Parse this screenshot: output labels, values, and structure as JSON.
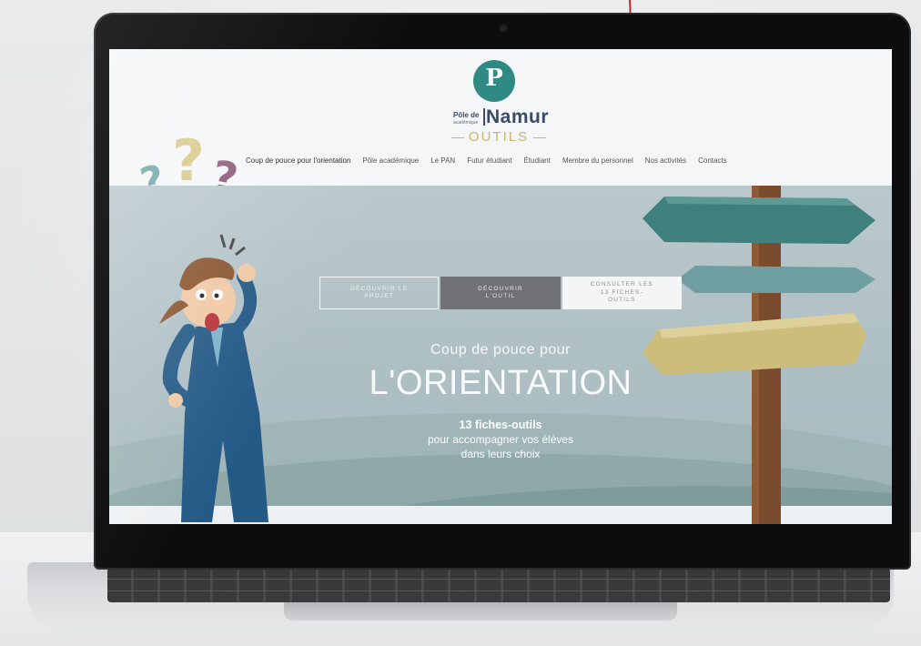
{
  "site": {
    "logo": {
      "glyph": "P",
      "pole": "Pôle de",
      "academique": "académique",
      "namur": "Namur",
      "outils": "OUTILS"
    },
    "nav": [
      {
        "label": "Coup de pouce pour l'orientation",
        "active": true
      },
      {
        "label": "Pôle académique"
      },
      {
        "label": "Le PAN"
      },
      {
        "label": "Futur étudiant"
      },
      {
        "label": "Étudiant"
      },
      {
        "label": "Membre du personnel"
      },
      {
        "label": "Nos activités"
      },
      {
        "label": "Contacts"
      }
    ],
    "question_marks": [
      "?",
      "?",
      "?"
    ],
    "hero": {
      "buttons": [
        {
          "label": "DÉCOUVRIR LE PROJET"
        },
        {
          "label": "DÉCOUVRIR L'OUTIL"
        },
        {
          "label": "CONSULTER LES 13 FICHES-OUTILS"
        }
      ],
      "subtitle": "Coup de pouce pour",
      "title": "L'ORIENTATION",
      "desc_bold": "13 fiches-outils",
      "desc_line2": "pour accompagner vos élèves",
      "desc_line3": "dans leurs choix"
    }
  },
  "colors": {
    "brand_teal": "#2f8a83",
    "brand_navy": "#3a4c68",
    "brand_gold": "#c8b46a",
    "hero_bg": "#aebfc4",
    "cta_dark": "#6f7174",
    "sign_teal": "#3f7f7c",
    "sign_gold": "#cdbd7a",
    "arrow_red": "#c0272d"
  }
}
